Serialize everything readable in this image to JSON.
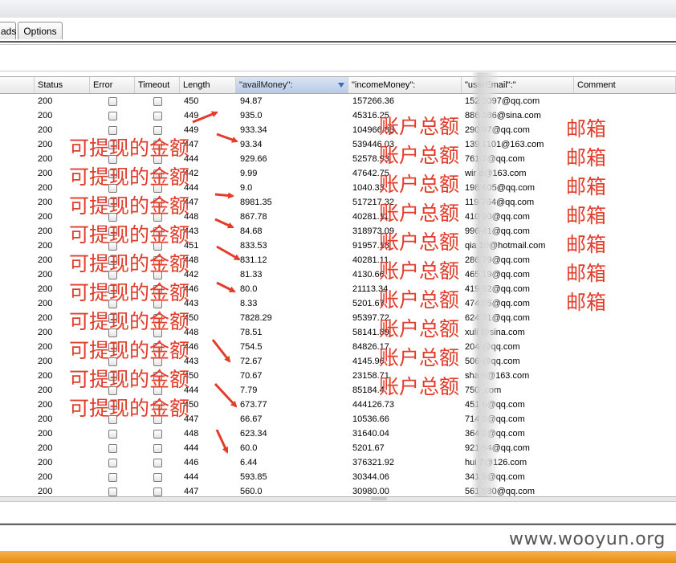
{
  "tabs": [
    {
      "label": "ads"
    },
    {
      "label": "Options"
    }
  ],
  "table": {
    "columns": [
      {
        "label": "Status"
      },
      {
        "label": "Error"
      },
      {
        "label": "Timeout"
      },
      {
        "label": "Length"
      },
      {
        "label": "\"availMoney\":"
      },
      {
        "label": "\"incomeMoney\":"
      },
      {
        "label": "\"userEmail\":\""
      },
      {
        "label": "Comment"
      }
    ],
    "sorted_column": "\"availMoney\":",
    "rows": [
      {
        "status": "200",
        "length": "450",
        "avail": "94.87",
        "income": "157266.36",
        "email": "152      3097@qq.com"
      },
      {
        "status": "200",
        "length": "449",
        "avail": "935.0",
        "income": "45316.25",
        "email": "886      386@sina.com"
      },
      {
        "status": "200",
        "length": "449",
        "avail": "933.34",
        "income": "104966.88",
        "email": "290      97@qq.com"
      },
      {
        "status": "200",
        "length": "447",
        "avail": "93.34",
        "income": "539446.03",
        "email": "139      1101@163.com"
      },
      {
        "status": "200",
        "length": "444",
        "avail": "929.66",
        "income": "52578.93",
        "email": "761      7@qq.com"
      },
      {
        "status": "200",
        "length": "442",
        "avail": "9.99",
        "income": "47642.75",
        "email": "wir      d@163.com"
      },
      {
        "status": "200",
        "length": "444",
        "avail": "9.0",
        "income": "1040.33",
        "email": "198      605@qq.com"
      },
      {
        "status": "200",
        "length": "447",
        "avail": "8981.35",
        "income": "517217.32",
        "email": "119      764@qq.com"
      },
      {
        "status": "200",
        "length": "448",
        "avail": "867.78",
        "income": "40281.11",
        "email": "410      90@qq.com"
      },
      {
        "status": "200",
        "length": "443",
        "avail": "84.68",
        "income": "318973.09",
        "email": "996      41@qq.com"
      },
      {
        "status": "200",
        "length": "451",
        "avail": "833.53",
        "income": "91957.18",
        "email": "qia      10@hotmail.com"
      },
      {
        "status": "200",
        "length": "448",
        "avail": "831.12",
        "income": "40281.11",
        "email": "286      79@qq.com"
      },
      {
        "status": "200",
        "length": "442",
        "avail": "81.33",
        "income": "4130.66",
        "email": "465      19@qq.com"
      },
      {
        "status": "200",
        "length": "446",
        "avail": "80.0",
        "income": "21113.34",
        "email": "419      92@qq.com"
      },
      {
        "status": "200",
        "length": "443",
        "avail": "8.33",
        "income": "5201.67",
        "email": "474      65@qq.com"
      },
      {
        "status": "200",
        "length": "450",
        "avail": "7828.29",
        "income": "95397.72",
        "email": "624      31@qq.com"
      },
      {
        "status": "200",
        "length": "448",
        "avail": "78.51",
        "income": "58141.89",
        "email": "xuli      @sina.com"
      },
      {
        "status": "200",
        "length": "446",
        "avail": "754.5",
        "income": "84826.17",
        "email": "204      @qq.com"
      },
      {
        "status": "200",
        "length": "443",
        "avail": "72.67",
        "income": "4145.96",
        "email": "506      @qq.com"
      },
      {
        "status": "200",
        "length": "450",
        "avail": "70.67",
        "income": "23158.71",
        "email": "sha      n@163.com"
      },
      {
        "status": "200",
        "length": "444",
        "avail": "7.79",
        "income": "85184.4",
        "email": "750      .com"
      },
      {
        "status": "200",
        "length": "450",
        "avail": "673.77",
        "income": "444126.73",
        "email": "451      6@qq.com"
      },
      {
        "status": "200",
        "length": "447",
        "avail": "66.67",
        "income": "10536.66",
        "email": "714      8@qq.com"
      },
      {
        "status": "200",
        "length": "448",
        "avail": "623.34",
        "income": "31640.04",
        "email": "364      2@qq.com"
      },
      {
        "status": "200",
        "length": "444",
        "avail": "60.0",
        "income": "5201.67",
        "email": "921      94@qq.com"
      },
      {
        "status": "200",
        "length": "446",
        "avail": "6.44",
        "income": "376321.92",
        "email": "hui      7@126.com"
      },
      {
        "status": "200",
        "length": "444",
        "avail": "593.85",
        "income": "30344.06",
        "email": "341      9@qq.com"
      },
      {
        "status": "200",
        "length": "447",
        "avail": "560.0",
        "income": "30980.00",
        "email": "561      580@qq.com"
      }
    ]
  },
  "annotations": {
    "avail_label": "可提现的金额",
    "income_label": "账户总额",
    "email_label": "邮箱"
  },
  "watermark": "www.wooyun.org",
  "colors": {
    "annotation": "#e23c2a",
    "sorted_header": "#b8cbe6",
    "footer_bar": "#f0a030"
  }
}
